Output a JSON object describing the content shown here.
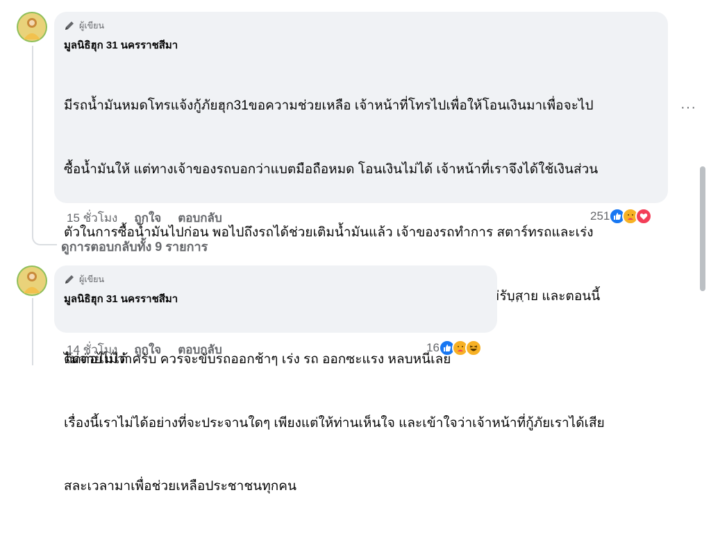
{
  "comments": [
    {
      "badge": "ผู้เขียน",
      "author": "มูลนิธิฮุก 31 นครราชสีมา",
      "lines": [
        "มีรถน้ำมันหมดโทรแจ้งกู้ภัยฮุก31ขอความช่วยเหลือ เจ้าหน้าที่โทรไปเพื่อให้โอนเงินมาเพื่อจะไป",
        "ซื้อน้ำมันให้ แต่ทางเจ้าของรถบอกว่าแบตมือถือหมด โอนเงินไม่ได้ เจ้าหน้าที่เราจึงได้ใช้เงินส่วน",
        "ตัวในการซื้อน้ำมันไปก่อน พอไปถึงรถได้ช่วยเติมน้ำมันแล้ว เจ้าของรถทำการ สตาร์ทรถและเร่ง",
        "เครื่องออกไปเลย เกือบจะเฉี่ยวเจ้าหน้าที่และรถกู้ภัย ทางเจ้าหน้าที่ได้โทรหาไม่รับสาย และตอนนี้",
        "ติดต่อไม่ได้",
        "เรื่องนี้เราไม่ได้อย่างที่จะประจานใดๆ เพียงแต่ให้ท่านเห็นใจ และเข้าใจว่าเจ้าหน้าที่กู้ภัยเราได้เสีย",
        "สละเวลามาเพื่อช่วยเหลือประชาชนทุกคน"
      ],
      "time": "15 ชั่วโมง",
      "like": "ถูกใจ",
      "reply": "ตอบกลับ",
      "reaction_count": "251",
      "reactions": [
        "like-icon",
        "care-icon",
        "love-icon"
      ],
      "more": "···"
    },
    {
      "badge": "ผู้เขียน",
      "author": "มูลนิธิฮุก 31 นครราชสีมา",
      "lines": [
        "ไม่จ่ายไม่ว่าครับ ควรจะขับรถออกช้าๆ เร่ง รถ ออกซะแรง หลบหนีเลย"
      ],
      "time": "14 ชั่วโมง",
      "like": "ถูกใจ",
      "reply": "ตอบกลับ",
      "reaction_count": "16",
      "reactions": [
        "like-icon",
        "care-icon",
        "haha-icon"
      ],
      "more": "···"
    }
  ],
  "view_replies": "ดูการตอบกลับทั้ง 9 รายการ",
  "colors": {
    "like": "#1877f2",
    "love": "#f33e58",
    "care": "#f7b125",
    "muted": "#65676b",
    "bubble": "#f0f2f5"
  }
}
